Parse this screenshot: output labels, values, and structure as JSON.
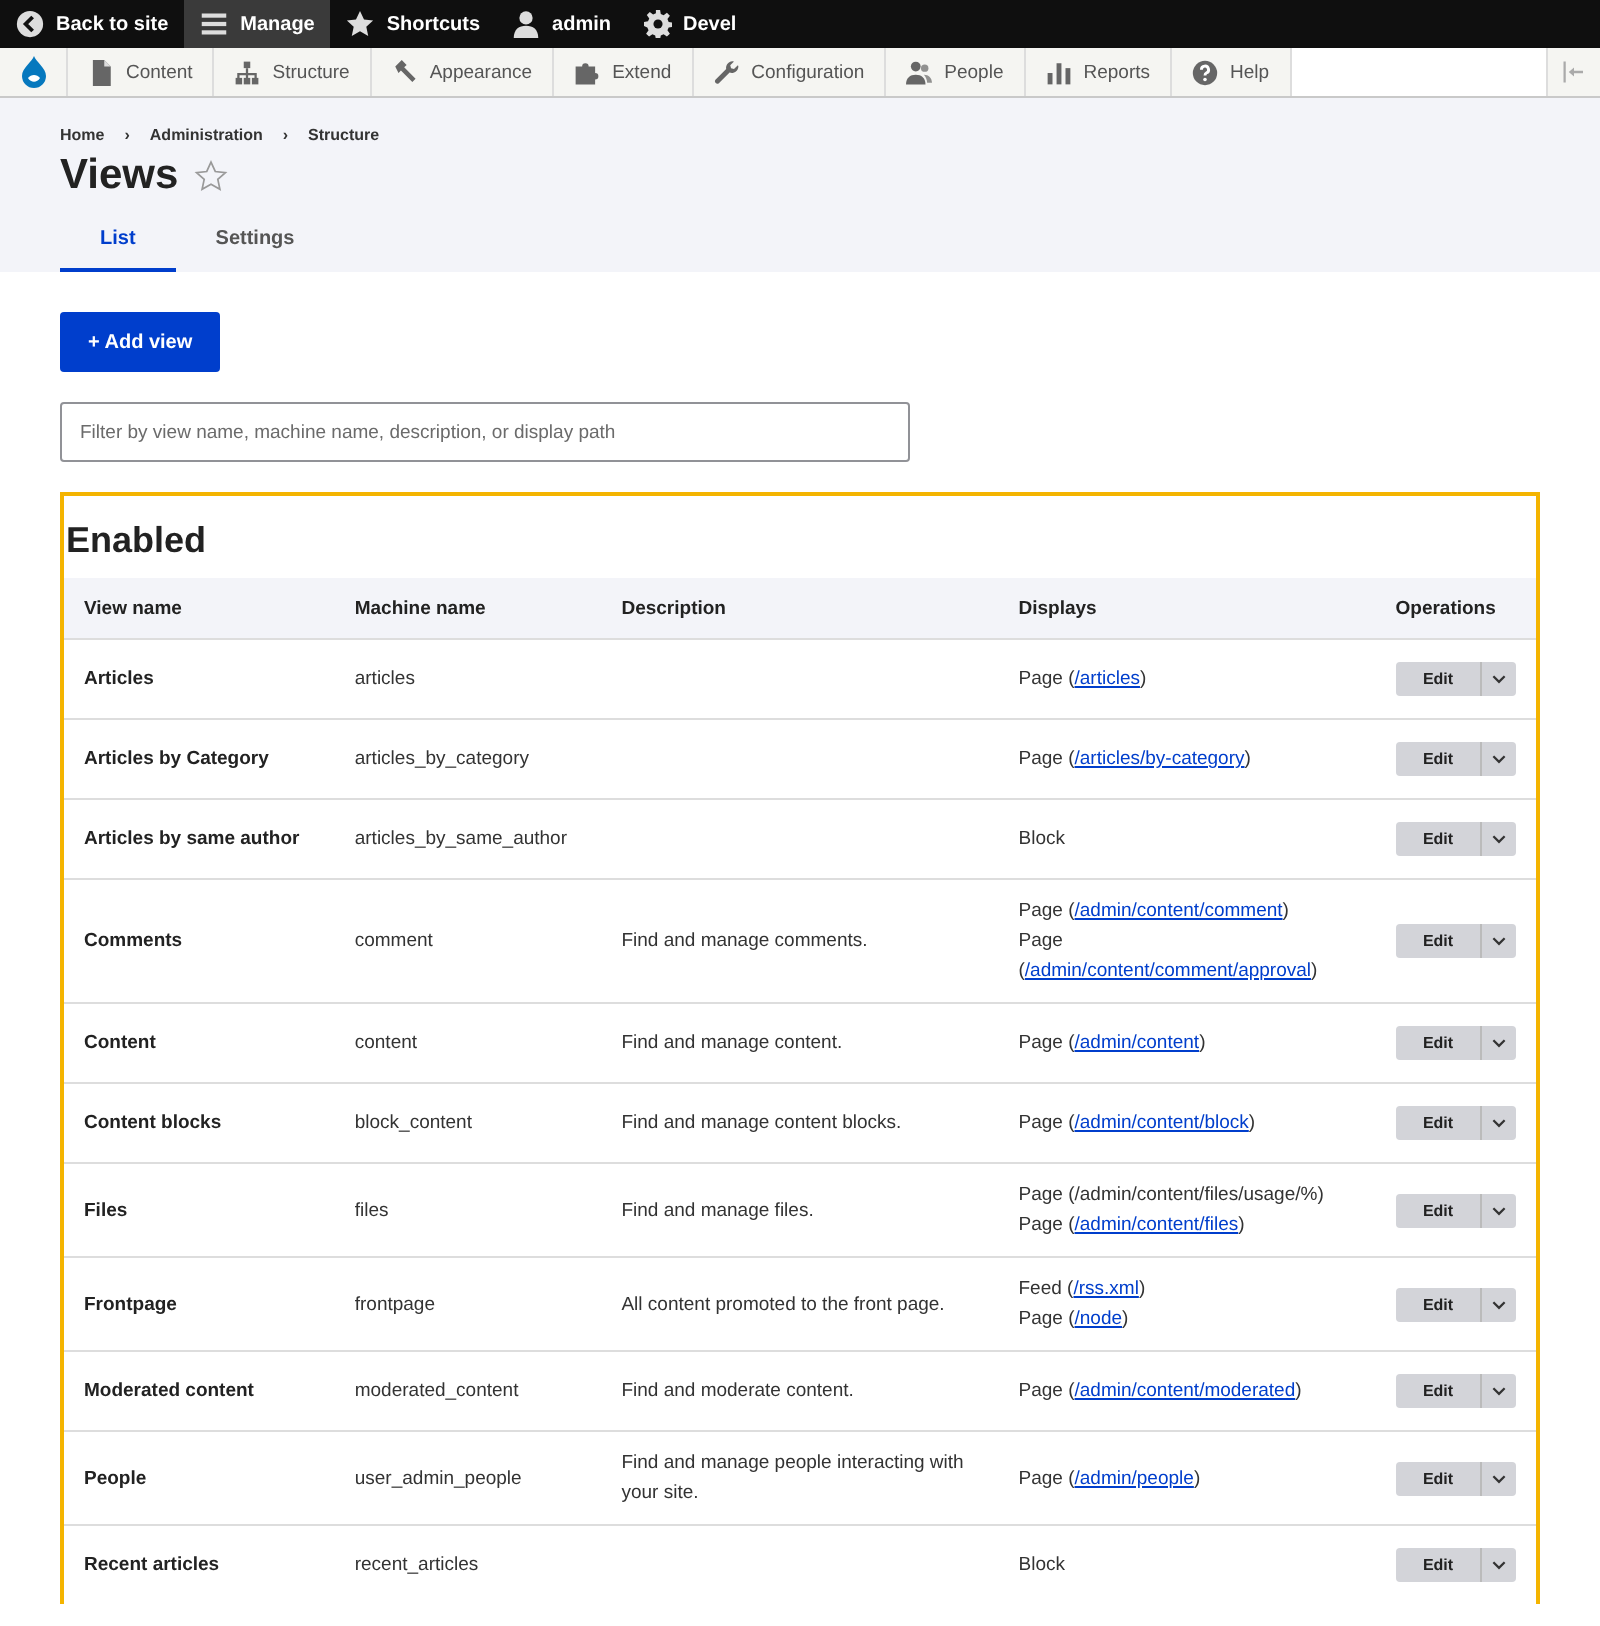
{
  "toolbar": {
    "items": [
      {
        "label": "Back to site",
        "selected": false
      },
      {
        "label": "Manage",
        "selected": true
      },
      {
        "label": "Shortcuts",
        "selected": false
      },
      {
        "label": "admin",
        "selected": false
      },
      {
        "label": "Devel",
        "selected": false
      }
    ]
  },
  "admin_menu": {
    "items": [
      {
        "label": "Content"
      },
      {
        "label": "Structure"
      },
      {
        "label": "Appearance"
      },
      {
        "label": "Extend"
      },
      {
        "label": "Configuration"
      },
      {
        "label": "People"
      },
      {
        "label": "Reports"
      },
      {
        "label": "Help"
      }
    ]
  },
  "breadcrumb": {
    "separator": "›",
    "items": [
      "Home",
      "Administration",
      "Structure"
    ]
  },
  "title": "Views",
  "shortcut_starred": false,
  "tabs": [
    {
      "label": "List",
      "selected": true
    },
    {
      "label": "Settings",
      "selected": false
    }
  ],
  "add_button": "+ Add view",
  "filter": {
    "placeholder": "Filter by view name, machine name, description, or display path"
  },
  "section": {
    "heading": "Enabled",
    "columns": [
      "View name",
      "Machine name",
      "Description",
      "Displays",
      "Operations"
    ],
    "rows": [
      {
        "name": "Articles",
        "machine_name": "articles",
        "description": "",
        "displays": [
          {
            "kind": "link",
            "before": "Page (",
            "link": "/articles",
            "after": ")"
          }
        ],
        "operation": "Edit"
      },
      {
        "name": "Articles by Category",
        "machine_name": "articles_by_category",
        "description": "",
        "displays": [
          {
            "kind": "link",
            "before": "Page (",
            "link": "/articles/by-category",
            "after": ")"
          }
        ],
        "operation": "Edit"
      },
      {
        "name": "Articles by same author",
        "machine_name": "articles_by_same_author",
        "description": "",
        "displays": [
          {
            "kind": "text",
            "text": "Block"
          }
        ],
        "operation": "Edit"
      },
      {
        "name": "Comments",
        "machine_name": "comment",
        "description": "Find and manage comments.",
        "displays": [
          {
            "kind": "link",
            "before": "Page (",
            "link": "/admin/content/comment",
            "after": ")"
          },
          {
            "kind": "link",
            "before": "Page (",
            "link": "/admin/content/comment/approval",
            "after": ")"
          }
        ],
        "operation": "Edit"
      },
      {
        "name": "Content",
        "machine_name": "content",
        "description": "Find and manage content.",
        "displays": [
          {
            "kind": "link",
            "before": "Page (",
            "link": "/admin/content",
            "after": ")"
          }
        ],
        "operation": "Edit"
      },
      {
        "name": "Content blocks",
        "machine_name": "block_content",
        "description": "Find and manage content blocks.",
        "displays": [
          {
            "kind": "link",
            "before": "Page (",
            "link": "/admin/content/block",
            "after": ")"
          }
        ],
        "operation": "Edit"
      },
      {
        "name": "Files",
        "machine_name": "files",
        "description": "Find and manage files.",
        "displays": [
          {
            "kind": "text",
            "text": "Page (/admin/content/files/usage/%)"
          },
          {
            "kind": "link",
            "before": "Page (",
            "link": "/admin/content/files",
            "after": ")"
          }
        ],
        "operation": "Edit"
      },
      {
        "name": "Frontpage",
        "machine_name": "frontpage",
        "description": "All content promoted to the front page.",
        "displays": [
          {
            "kind": "link",
            "before": "Feed (",
            "link": "/rss.xml",
            "after": ")"
          },
          {
            "kind": "link",
            "before": "Page (",
            "link": "/node",
            "after": ")"
          }
        ],
        "operation": "Edit"
      },
      {
        "name": "Moderated content",
        "machine_name": "moderated_content",
        "description": "Find and moderate content.",
        "displays": [
          {
            "kind": "link",
            "before": "Page (",
            "link": "/admin/content/moderated",
            "after": ")"
          }
        ],
        "operation": "Edit"
      },
      {
        "name": "People",
        "machine_name": "user_admin_people",
        "description": "Find and manage people interacting with your site.",
        "displays": [
          {
            "kind": "link",
            "before": "Page (",
            "link": "/admin/people",
            "after": ")"
          }
        ],
        "operation": "Edit"
      },
      {
        "name": "Recent articles",
        "machine_name": "recent_articles",
        "description": "",
        "displays": [
          {
            "kind": "text",
            "text": "Block"
          }
        ],
        "operation": "Edit"
      }
    ]
  }
}
